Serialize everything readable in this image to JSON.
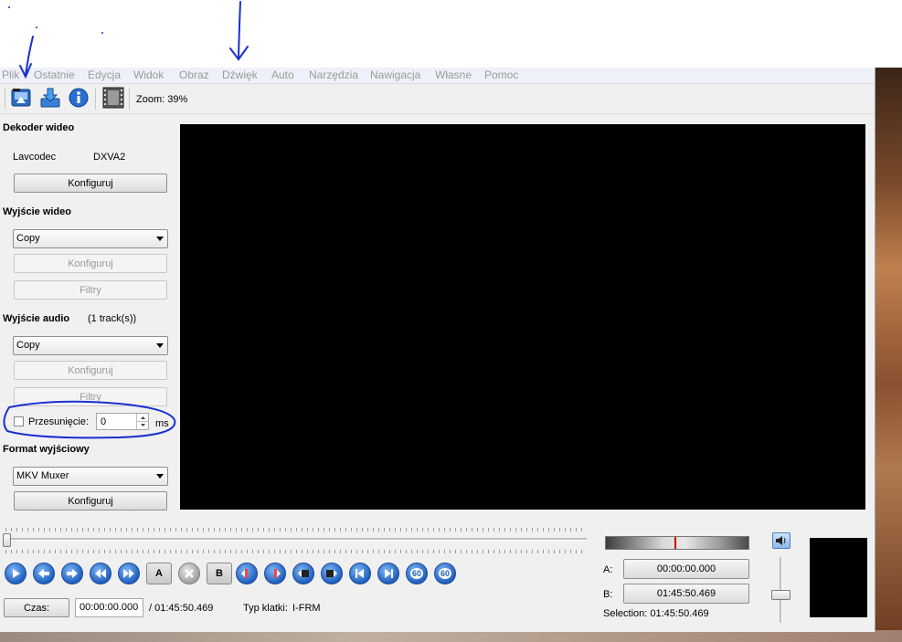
{
  "menu": {
    "items": [
      "Plik",
      "Ostatnie",
      "Edycja",
      "Widok",
      "Obraz",
      "Dźwięk",
      "Auto",
      "Narzędzia",
      "Nawigacja",
      "Własne",
      "Pomoc"
    ]
  },
  "toolbar": {
    "icons": [
      "open-video-icon",
      "save-video-icon",
      "info-icon",
      "film-icon"
    ],
    "zoom_label": "Zoom: 39%"
  },
  "video_decoder": {
    "title": "Dekoder wideo",
    "codec_label": "Lavcodec",
    "codec_value": "DXVA2",
    "configure_label": "Konfiguruj"
  },
  "video_output": {
    "title": "Wyjście wideo",
    "selected": "Copy",
    "configure_label": "Konfiguruj",
    "filters_label": "Filtry"
  },
  "audio_output": {
    "title": "Wyjście audio",
    "tracks": "(1 track(s))",
    "selected": "Copy",
    "configure_label": "Konfiguruj",
    "filters_label": "Filtry",
    "shift_label": "Przesunięcie:",
    "shift_value": "0",
    "shift_unit": "ms"
  },
  "output_format": {
    "title": "Format wyjściowy",
    "selected": "MKV Muxer",
    "configure_label": "Konfiguruj"
  },
  "navigation": {
    "buttons": [
      "play",
      "rewind",
      "forward",
      "prev-keyframe",
      "next-keyframe",
      "set-marker-a",
      "delete",
      "set-marker-b",
      "go-marker-a",
      "go-marker-b",
      "prev-cut",
      "next-cut",
      "go-first",
      "go-last",
      "back-60",
      "forward-60"
    ],
    "label_a": "A",
    "label_b": "B",
    "label_60a": "60",
    "label_60b": "60"
  },
  "status": {
    "time_button": "Czas:",
    "current_time": "00:00:00.000",
    "total_time": "/ 01:45:50.469",
    "frame_type_label": "Typ klatki:",
    "frame_type_value": "I-FRM"
  },
  "selection": {
    "a_label": "A:",
    "a_value": "00:00:00.000",
    "b_label": "B:",
    "b_value": "01:45:50.469",
    "summary": "Selection: 01:45:50.469"
  },
  "colors": {
    "annotation_ink": "#1a2fd0",
    "nav_blue": "#1f5fbf",
    "marker_red": "#cc0000"
  }
}
